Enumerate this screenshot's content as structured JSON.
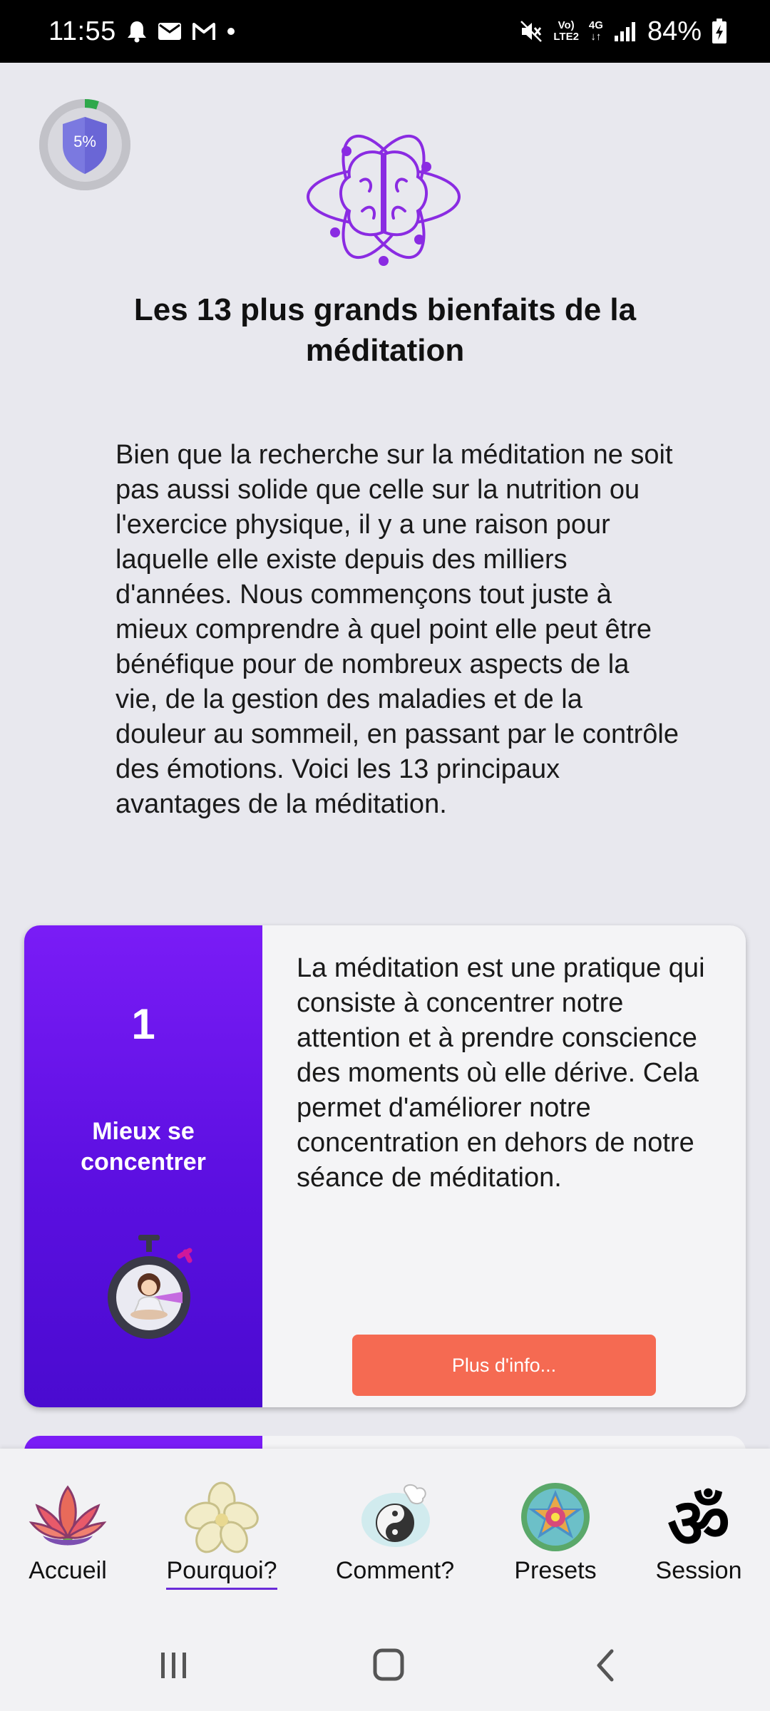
{
  "status_bar": {
    "time": "11:55",
    "battery": "84%",
    "network_top": "Vo)",
    "network_bottom": "LTE2",
    "data_top": "4G",
    "icons_left": [
      "bell-icon",
      "mail-icon",
      "gmail-icon",
      "dot-icon"
    ],
    "icons_right": [
      "mute-icon",
      "volte-icon",
      "4g-icon",
      "signal-icon",
      "battery-charging-icon"
    ]
  },
  "progress": {
    "label": "5%",
    "value": 0.05
  },
  "page": {
    "title": "Les 13 plus grands bienfaits de la méditation",
    "intro": "Bien que la recherche sur la méditation ne soit pas aussi solide que celle sur la nutrition ou l'exercice physique, il y a une raison pour laquelle elle existe depuis des milliers d'années. Nous commençons tout juste à mieux comprendre à quel point elle peut être bénéfique pour de nombreux aspects de la vie, de la gestion des maladies et de la douleur au sommeil, en passant par le contrôle des émotions. Voici les 13 principaux avantages de la méditation."
  },
  "benefit_card": {
    "number": "1",
    "title": "Mieux se concentrer",
    "text": "La méditation est une pratique qui consiste à concentrer notre attention et à prendre conscience des moments où elle dérive. Cela permet d'améliorer notre concentration en dehors de notre séance de méditation.",
    "button_label": "Plus d'info..."
  },
  "bottom_nav": {
    "items": [
      {
        "label": "Accueil",
        "icon": "lotus-icon"
      },
      {
        "label": "Pourquoi?",
        "icon": "flower-icon",
        "active": true
      },
      {
        "label": "Comment?",
        "icon": "yin-yang-icon"
      },
      {
        "label": "Presets",
        "icon": "mandala-icon"
      },
      {
        "label": "Session",
        "icon": "om-icon"
      }
    ]
  },
  "colors": {
    "accent_purple": "#7a1cf6",
    "button_coral": "#f56a52",
    "background": "#e8e8ee",
    "brain_icon": "#8a2be2"
  }
}
